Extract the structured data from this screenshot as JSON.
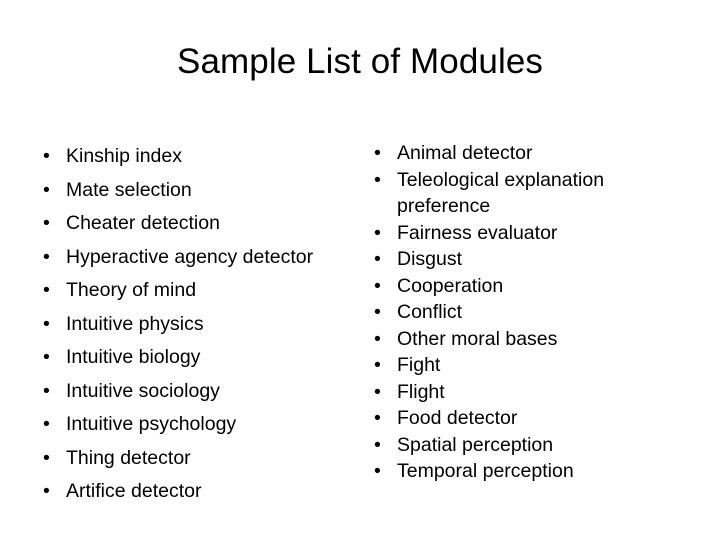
{
  "slide": {
    "title": "Sample List of Modules",
    "background_color": "#ffffff",
    "text_color": "#000000",
    "bullet_glyph": "•"
  },
  "columns": {
    "left": {
      "items": [
        "Kinship index",
        "Mate selection",
        "Cheater detection",
        "Hyperactive agency detector",
        "Theory of mind",
        "Intuitive physics",
        "Intuitive biology",
        "Intuitive sociology",
        "Intuitive psychology",
        "Thing detector",
        "Artifice detector"
      ]
    },
    "right": {
      "items": [
        "Animal detector",
        "Teleological explanation preference",
        "Fairness evaluator",
        "Disgust",
        "Cooperation",
        "Conflict",
        "Other moral bases",
        "Fight",
        "Flight",
        "Food detector",
        "Spatial perception",
        "Temporal perception"
      ]
    }
  }
}
